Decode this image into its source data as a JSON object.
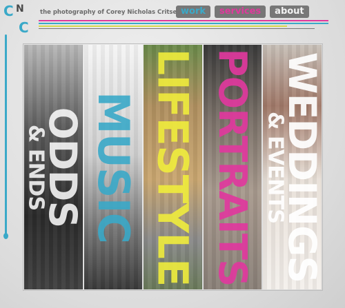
{
  "logo": {
    "letter1": "C",
    "letter2": "N",
    "letter3": "C"
  },
  "tagline": "the photography of Corey Nicholas Critser",
  "nav": [
    {
      "label": "work"
    },
    {
      "label": "services"
    },
    {
      "label": "about"
    }
  ],
  "panels": [
    {
      "main": "ODDS",
      "sub": "& ENDS"
    },
    {
      "main": "MUSIC",
      "sub": ""
    },
    {
      "main": "LIFESTYLE",
      "sub": ""
    },
    {
      "main": "PORTRAITS",
      "sub": ""
    },
    {
      "main": "WEDDINGS",
      "sub": "& EVENTS"
    }
  ],
  "colors": {
    "cyan": "#3aa9c8",
    "magenta": "#e0389d",
    "yellow": "#d8d84a",
    "nav_bg": "#777777"
  }
}
